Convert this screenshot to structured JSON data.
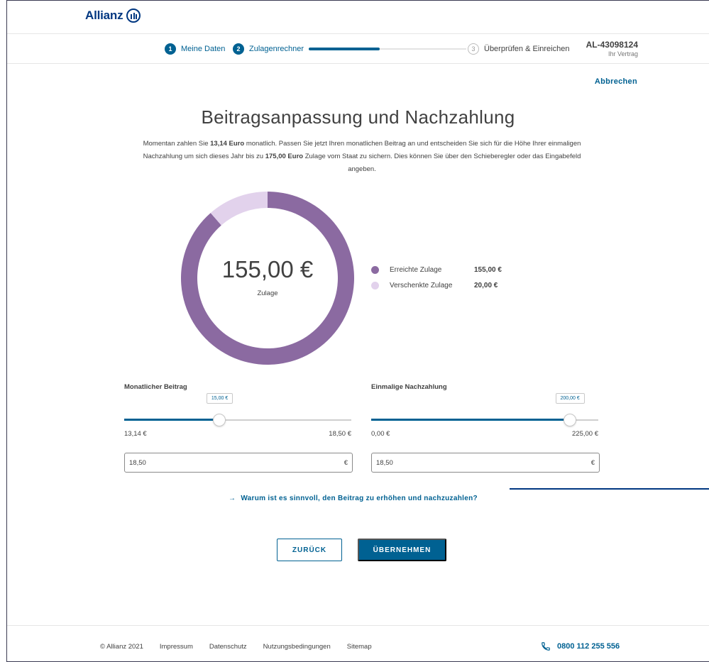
{
  "brand": {
    "name": "Allianz"
  },
  "steps": [
    {
      "num": "1",
      "label": "Meine Daten"
    },
    {
      "num": "2",
      "label": "Zulagenrechner"
    },
    {
      "num": "3",
      "label": "Überprüfen & Einreichen"
    }
  ],
  "step_progress": 0.45,
  "contract": {
    "number": "AL-43098124",
    "label": "Ihr Vertrag"
  },
  "cancel_label": "Abbrechen",
  "title": "Beitragsanpassung und Nachzahlung",
  "intro": {
    "p1": "Momentan zahlen Sie ",
    "current": "13,14 Euro",
    "p2": " monatlich. Passen Sie jetzt Ihren monatlichen Beitrag an und entscheiden Sie sich für die Höhe Ihrer einmaligen Nachzahlung um sich dieses Jahr bis zu ",
    "max": "175,00 Euro",
    "p3": " Zulage vom Staat zu sichern. Dies können Sie über den Schieberegler oder das Eingabefeld angeben."
  },
  "chart_data": {
    "type": "pie",
    "categories": [
      "Erreichte Zulage",
      "Verschenkte Zulage"
    ],
    "values": [
      155,
      20
    ],
    "colors": [
      "#8b6aa1",
      "#e2d2ec"
    ],
    "center_value": "155,00 €",
    "center_caption": "Zulage",
    "legend_values": [
      "155,00 €",
      "20,00 €"
    ],
    "legend_position": "right"
  },
  "monthly": {
    "title": "Monatlicher Beitrag",
    "tooltip": "15,00 €",
    "min_label": "13,14 €",
    "max_label": "18,50 €",
    "position": 0.42,
    "input_value": "18,50",
    "currency": "€"
  },
  "oneoff": {
    "title": "Einmalige Nachzahlung",
    "tooltip": "200,00 €",
    "min_label": "0,00 €",
    "max_label": "225,00 €",
    "position": 0.875,
    "input_value": "18,50",
    "currency": "€"
  },
  "info_link": {
    "arrow": "→",
    "label": "Warum ist es sinnvoll, den Beitrag zu erhöhen und nachzuzahlen?"
  },
  "buttons": {
    "back": "ZURÜCK",
    "apply": "ÜBERNEHMEN"
  },
  "footer": {
    "copyright": "© Allianz 2021",
    "links": [
      "Impressum",
      "Datenschutz",
      "Nutzungsbedingungen",
      "Sitemap"
    ],
    "phone": "0800 112 255 556"
  },
  "colors": {
    "primary": "#006192",
    "brand": "#003781"
  }
}
